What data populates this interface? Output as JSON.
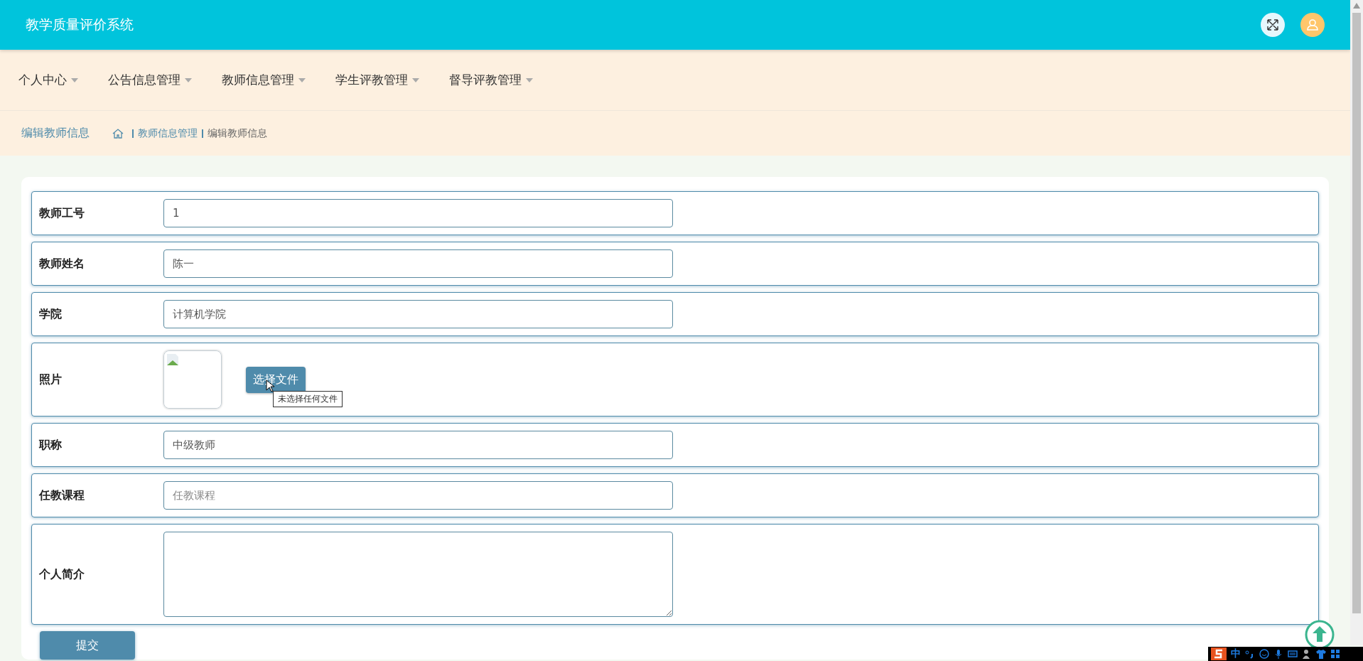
{
  "header": {
    "title": "教学质量评价系统"
  },
  "nav": {
    "items": [
      {
        "label": "个人中心"
      },
      {
        "label": "公告信息管理"
      },
      {
        "label": "教师信息管理"
      },
      {
        "label": "学生评教管理"
      },
      {
        "label": "督导评教管理"
      }
    ]
  },
  "breadcrumb": {
    "page_title": "编辑教师信息",
    "trail": [
      "教师信息管理",
      "编辑教师信息"
    ]
  },
  "form": {
    "fields": [
      {
        "kind": "text",
        "label": "教师工号",
        "value": "1"
      },
      {
        "kind": "text",
        "label": "教师姓名",
        "value": "陈一"
      },
      {
        "kind": "text",
        "label": "学院",
        "value": "计算机学院"
      },
      {
        "kind": "photo",
        "label": "照片",
        "button": "选择文件",
        "tooltip": "未选择任何文件"
      },
      {
        "kind": "text",
        "label": "职称",
        "value": "中级教师"
      },
      {
        "kind": "text",
        "label": "任教课程",
        "placeholder": "任教课程"
      },
      {
        "kind": "textarea",
        "label": "个人简介"
      }
    ],
    "submit": "提交"
  },
  "ime_toolbar": {
    "mode": "中"
  }
}
